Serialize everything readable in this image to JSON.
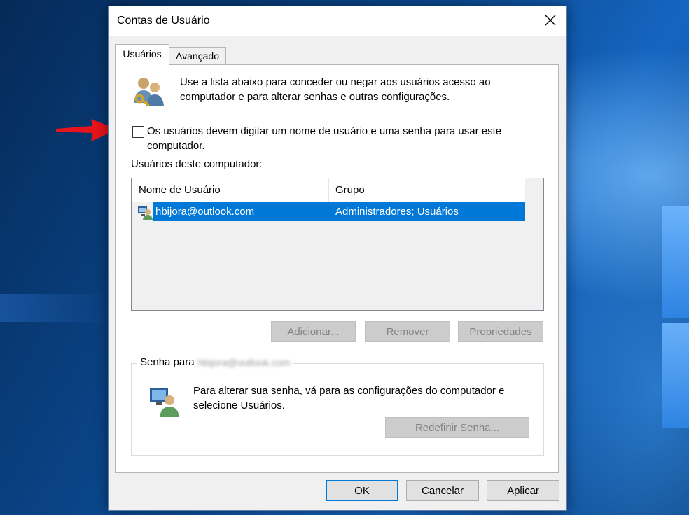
{
  "dialog": {
    "title": "Contas de Usuário"
  },
  "tabs": [
    {
      "label": "Usuários",
      "active": true
    },
    {
      "label": "Avançado",
      "active": false
    }
  ],
  "intro": {
    "text": "Use a lista abaixo para conceder ou negar aos usuários acesso ao computador e para alterar senhas e outras configurações."
  },
  "require_password": {
    "label": "Os usuários devem digitar um nome de usuário e uma senha para usar este computador.",
    "checked": false
  },
  "users_section": {
    "label": "Usuários deste computador:",
    "columns": [
      "Nome de Usuário",
      "Grupo"
    ],
    "rows": [
      {
        "name": "hbijora@outlook.com",
        "group": "Administradores; Usuários",
        "selected": true
      }
    ]
  },
  "list_buttons": {
    "add": "Adicionar...",
    "remove": "Remover",
    "properties": "Propriedades"
  },
  "password_group": {
    "legend": "Senha para",
    "blurred_account": "hbijora@outlook.com",
    "text": "Para alterar sua senha, vá para as configurações do computador e selecione Usuários.",
    "reset_button": "Redefinir Senha..."
  },
  "footer": {
    "ok": "OK",
    "cancel": "Cancelar",
    "apply": "Aplicar"
  },
  "colors": {
    "selection": "#0078d7",
    "annotation_arrow": "#e8141b"
  },
  "icons": {
    "intro": "users-key-icon",
    "row": "user-account-icon",
    "password": "user-computer-icon",
    "close": "close-icon",
    "arrow": "red-arrow-icon"
  }
}
